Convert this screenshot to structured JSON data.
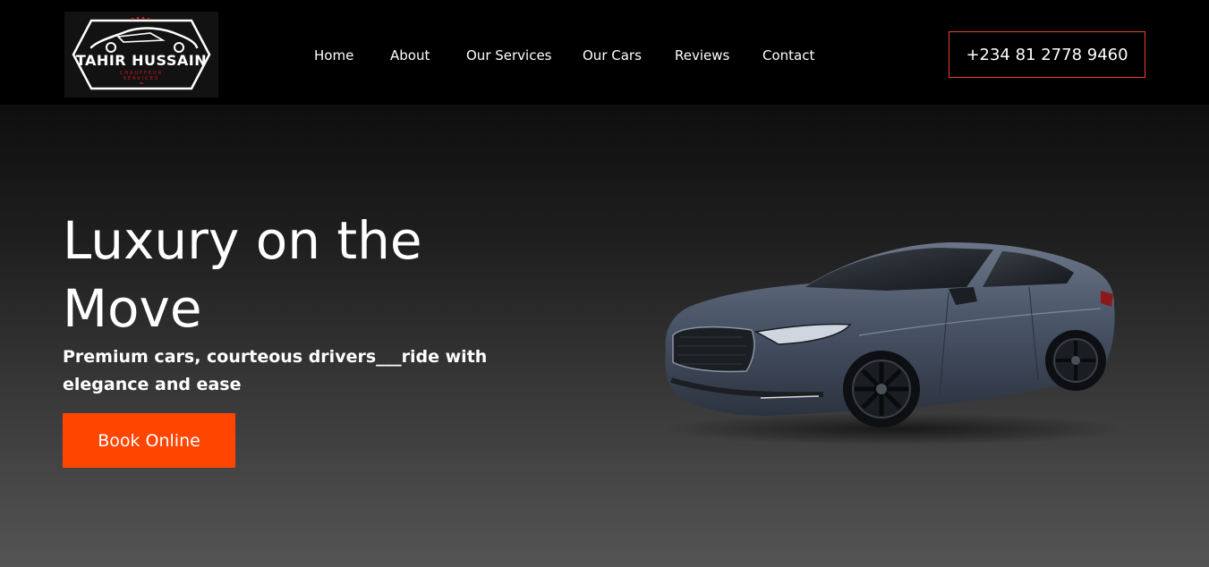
{
  "brand": {
    "title": "TAHIR HUSSAIN",
    "subtitle_line1": "CHAUFFEUR",
    "subtitle_line2": "SERVICES",
    "logo_icon": "car-silhouette-icon"
  },
  "nav": {
    "items": [
      {
        "label": "Home"
      },
      {
        "label": "About"
      },
      {
        "label": "Our Services"
      },
      {
        "label": "Our Cars"
      },
      {
        "label": "Reviews"
      },
      {
        "label": "Contact"
      }
    ]
  },
  "header": {
    "phone": "+234 81 2778 9460"
  },
  "hero": {
    "title": "Luxury on the Move",
    "subtitle": "Premium cars, courteous drivers___ride with elegance and ease",
    "cta_label": "Book Online",
    "car_image": "luxury-sedan-image"
  },
  "colors": {
    "accent": "#ff4500",
    "phone_border": "#e8452a",
    "header_bg": "#000000",
    "car_body": "#4a5568"
  }
}
